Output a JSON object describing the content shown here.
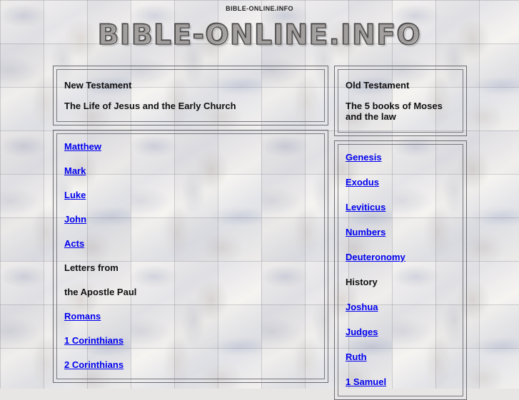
{
  "page": {
    "top_title": "BIBLE-ONLINE.INFO",
    "logo_text": "BIBLE-ONLINE.INFO",
    "link_color": "#0000ee",
    "text_color": "#101010",
    "border_color": "#6b6b73"
  },
  "columns": [
    {
      "id": "new-testament",
      "header": {
        "title": "New Testament",
        "subtitle": "The Life of Jesus and the Early Church"
      },
      "entries": [
        {
          "label": "Matthew",
          "type": "link"
        },
        {
          "label": "Mark",
          "type": "link"
        },
        {
          "label": "Luke",
          "type": "link"
        },
        {
          "label": "John",
          "type": "link"
        },
        {
          "label": "Acts",
          "type": "link"
        },
        {
          "label": "Letters from",
          "type": "text"
        },
        {
          "label": "the Apostle Paul",
          "type": "text"
        },
        {
          "label": "Romans",
          "type": "link"
        },
        {
          "label": "1 Corinthians",
          "type": "link"
        },
        {
          "label": "2 Corinthians",
          "type": "link"
        }
      ]
    },
    {
      "id": "old-testament",
      "header": {
        "title": "Old Testament",
        "subtitle": "The 5 books of Moses",
        "subtitle2": "and the law"
      },
      "entries": [
        {
          "label": "Genesis",
          "type": "link"
        },
        {
          "label": "Exodus",
          "type": "link"
        },
        {
          "label": "Leviticus",
          "type": "link"
        },
        {
          "label": "Numbers",
          "type": "link"
        },
        {
          "label": "Deuteronomy",
          "type": "link"
        },
        {
          "label": "History",
          "type": "text"
        },
        {
          "label": "Joshua",
          "type": "link"
        },
        {
          "label": "Judges",
          "type": "link"
        },
        {
          "label": "Ruth",
          "type": "link"
        },
        {
          "label": "1 Samuel",
          "type": "link"
        }
      ]
    }
  ]
}
